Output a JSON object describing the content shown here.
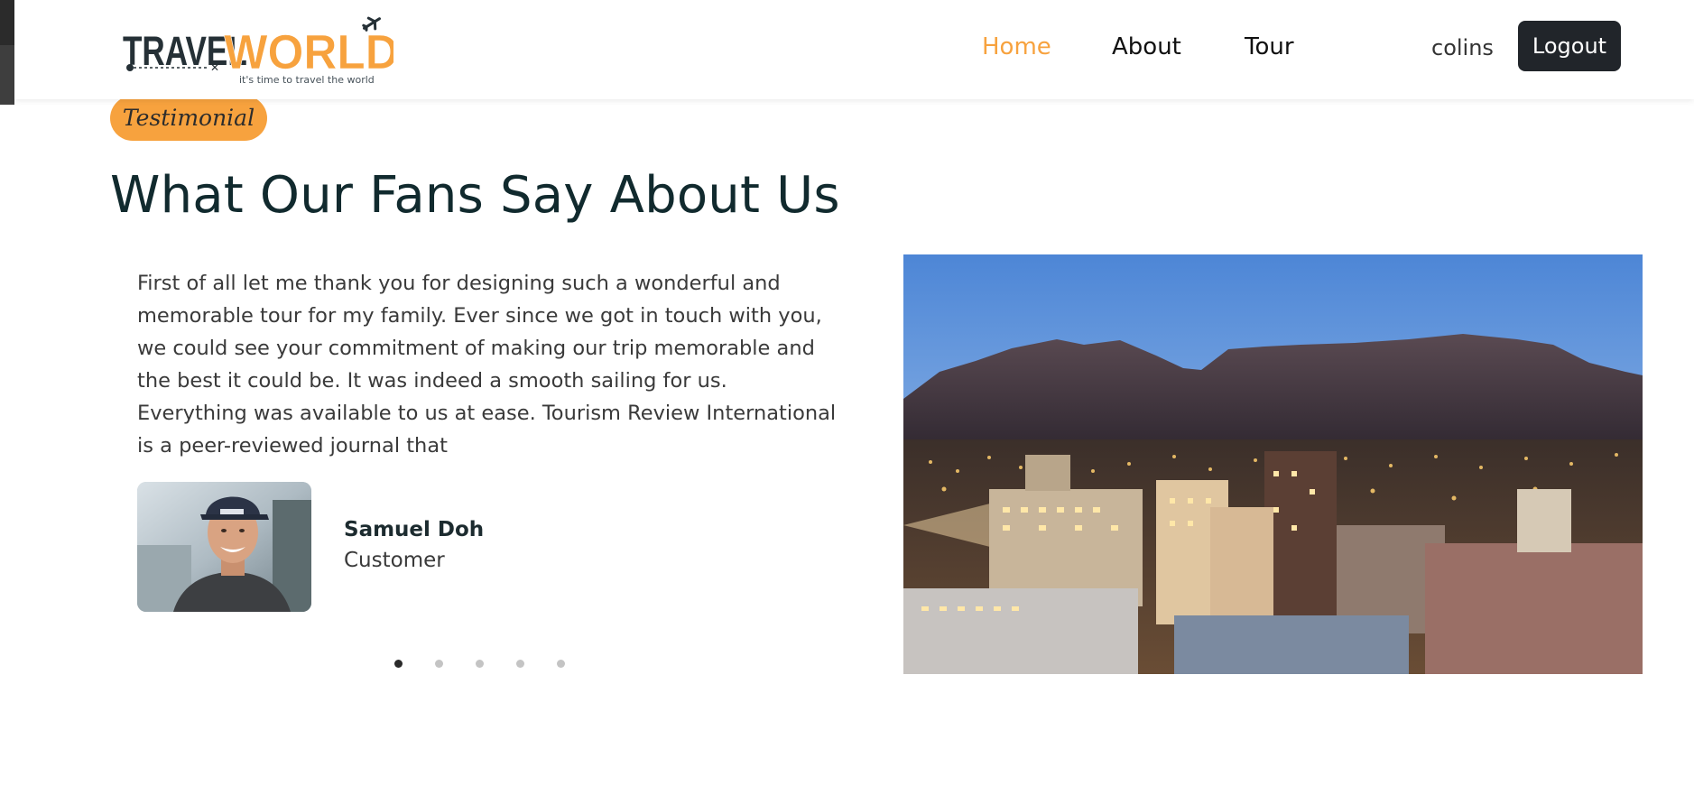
{
  "brand": {
    "name_part1": "TRAVEL",
    "name_part2": "WORLD",
    "tagline": "it's time to travel the world",
    "primary_color": "#f7a23e",
    "dark_color": "#21252a"
  },
  "nav": {
    "items": [
      {
        "label": "Home",
        "active": true
      },
      {
        "label": "About",
        "active": false
      },
      {
        "label": "Tour",
        "active": false
      }
    ],
    "username": "colins",
    "logout_label": "Logout"
  },
  "testimonials": {
    "subtitle": "Testimonial",
    "title": "What Our Fans Say About Us",
    "active_index": 0,
    "slide_count": 5,
    "current": {
      "quote": "First of all let me thank you for designing such a wonderful and memorable tour for my family. Ever since we got in touch with you, we could see your commitment of making our trip memorable and the best it could be. It was indeed a smooth sailing for us. Everything was available to us at ease. Tourism Review International is a peer-reviewed journal that",
      "author_name": "Samuel Doh",
      "author_role": "Customer",
      "avatar_icon": "customer-photo"
    }
  },
  "hero_image": {
    "icon": "city-night-skyline-photo"
  }
}
